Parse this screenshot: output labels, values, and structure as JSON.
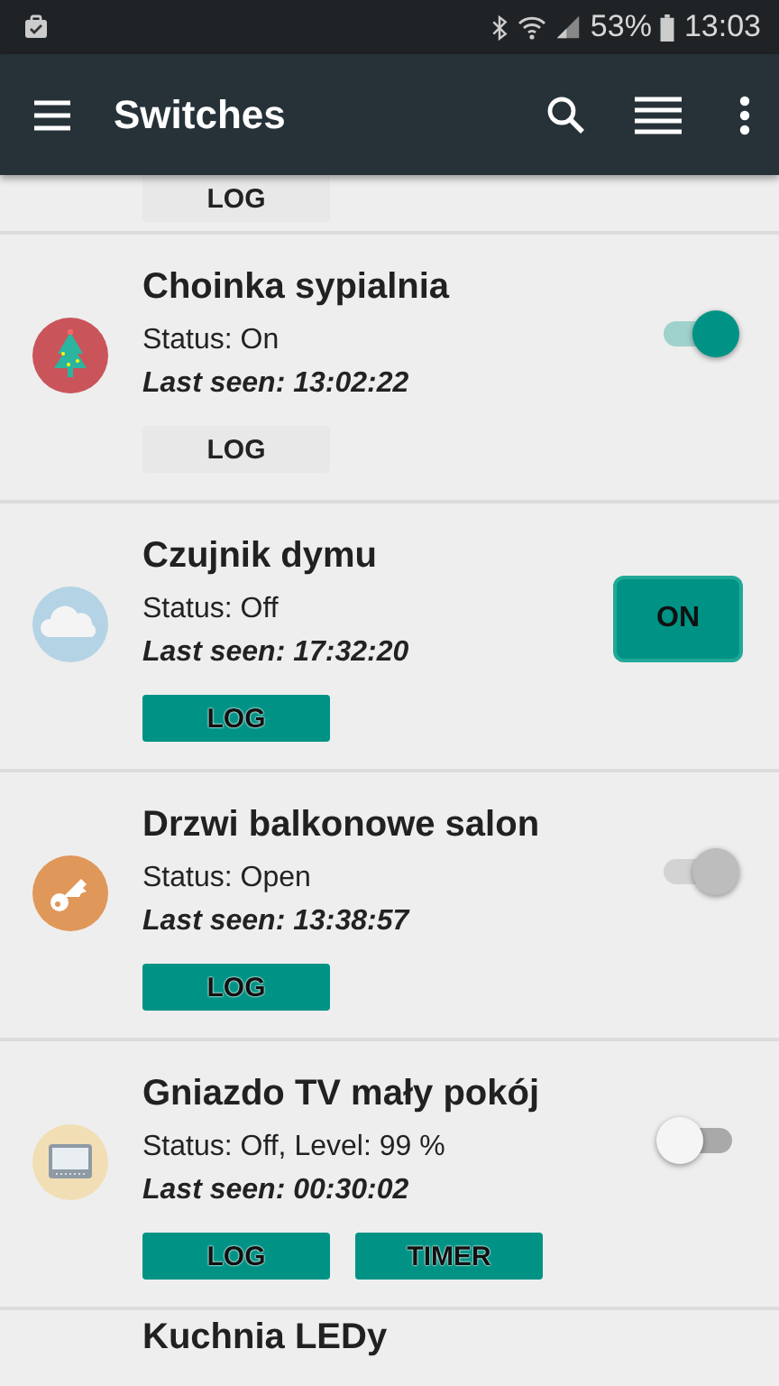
{
  "status_bar": {
    "battery": "53%",
    "time": "13:03"
  },
  "app_bar": {
    "title": "Switches"
  },
  "devices": [
    {
      "buttons": [
        {
          "label": "LOG",
          "filled": false
        }
      ]
    },
    {
      "name": "Choinka sypialnia",
      "kind": "tree",
      "color": "#c9555a",
      "status": "Status: On",
      "last_seen": "Last seen: 13:02:22",
      "control": {
        "kind": "switch",
        "on": true,
        "disabled": false
      },
      "buttons": [
        {
          "label": "LOG",
          "filled": false
        }
      ]
    },
    {
      "name": "Czujnik dymu",
      "kind": "cloud",
      "color": "#b4d3e5",
      "status": "Status: Off",
      "last_seen": "Last seen: 17:32:20",
      "control": {
        "kind": "button",
        "label": "ON"
      },
      "buttons": [
        {
          "label": "LOG",
          "filled": true
        }
      ]
    },
    {
      "name": "Drzwi balkonowe salon",
      "kind": "key",
      "color": "#e0975a",
      "status": "Status: Open",
      "last_seen": "Last seen: 13:38:57",
      "control": {
        "kind": "switch",
        "on": true,
        "disabled": true
      },
      "buttons": [
        {
          "label": "LOG",
          "filled": true
        }
      ]
    },
    {
      "name": "Gniazdo TV mały pokój",
      "kind": "tv",
      "color": "#f2deb4",
      "status": "Status: Off, Level: 99 %",
      "last_seen": "Last seen: 00:30:02",
      "control": {
        "kind": "switch",
        "on": false,
        "disabled": false
      },
      "buttons": [
        {
          "label": "LOG",
          "filled": true
        },
        {
          "label": "TIMER",
          "filled": true
        }
      ]
    },
    {
      "name": "Kuchnia LEDy"
    }
  ]
}
